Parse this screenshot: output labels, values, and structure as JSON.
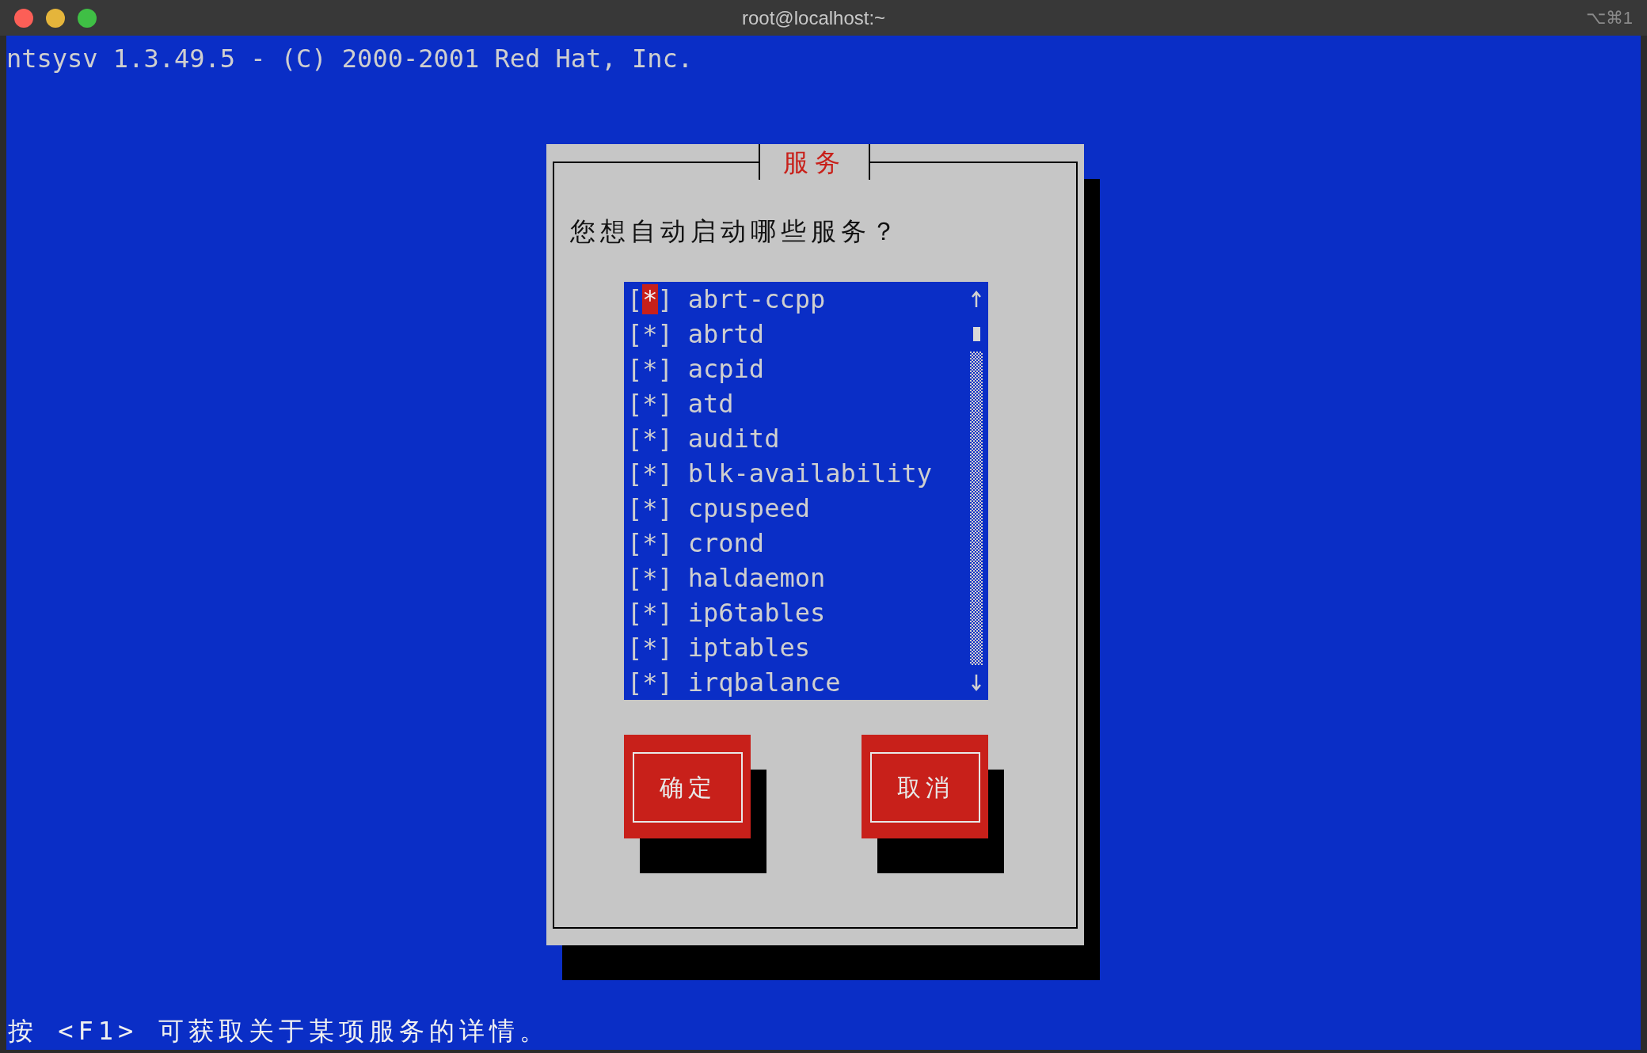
{
  "window": {
    "title": "root@localhost:~",
    "shortcut": "⌥⌘1"
  },
  "header": "ntsysv 1.3.49.5 - (C) 2000-2001 Red Hat, Inc.",
  "dialog": {
    "title": "服务",
    "question": "您想自动启动哪些服务？",
    "services": [
      {
        "checkbox": "[*]",
        "name": "abrt-ccpp",
        "selected": true
      },
      {
        "checkbox": "[*]",
        "name": "abrtd",
        "selected": false
      },
      {
        "checkbox": "[*]",
        "name": "acpid",
        "selected": false
      },
      {
        "checkbox": "[*]",
        "name": "atd",
        "selected": false
      },
      {
        "checkbox": "[*]",
        "name": "auditd",
        "selected": false
      },
      {
        "checkbox": "[*]",
        "name": "blk-availability",
        "selected": false
      },
      {
        "checkbox": "[*]",
        "name": "cpuspeed",
        "selected": false
      },
      {
        "checkbox": "[*]",
        "name": "crond",
        "selected": false
      },
      {
        "checkbox": "[*]",
        "name": "haldaemon",
        "selected": false
      },
      {
        "checkbox": "[*]",
        "name": "ip6tables",
        "selected": false
      },
      {
        "checkbox": "[*]",
        "name": "iptables",
        "selected": false
      },
      {
        "checkbox": "[*]",
        "name": "irqbalance",
        "selected": false
      }
    ],
    "buttons": [
      "确定",
      "取消"
    ]
  },
  "footer": "按 <F1> 可获取关于某项服务的详情。"
}
